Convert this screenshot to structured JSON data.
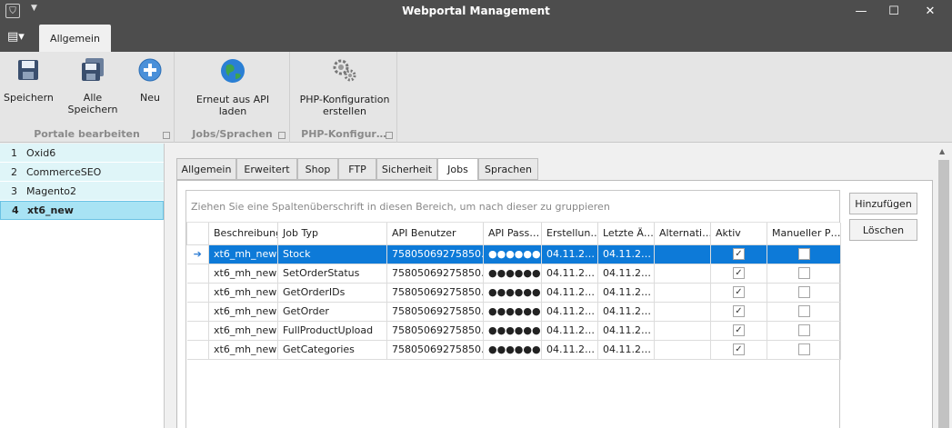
{
  "window": {
    "title": "Webportal Management",
    "minimize": "—",
    "maximize": "☐",
    "close": "✕"
  },
  "ribbon": {
    "tab": "Allgemein",
    "groups": [
      {
        "label": "Portale bearbeiten",
        "buttons": [
          "Speichern",
          "Alle Speichern",
          "Neu"
        ]
      },
      {
        "label": "Jobs/Sprachen",
        "buttons": [
          "Erneut aus API laden"
        ]
      },
      {
        "label": "PHP-Konfigur…",
        "buttons": [
          "PHP-Konfiguration erstellen"
        ]
      }
    ]
  },
  "portals": [
    {
      "num": "1",
      "name": "Oxid6"
    },
    {
      "num": "2",
      "name": "CommerceSEO"
    },
    {
      "num": "3",
      "name": "Magento2"
    },
    {
      "num": "4",
      "name": "xt6_new"
    }
  ],
  "tabs": [
    "Allgemein",
    "Erweitert",
    "Shop",
    "FTP",
    "Sicherheit",
    "Jobs",
    "Sprachen"
  ],
  "active_tab": "Jobs",
  "grid": {
    "group_hint": "Ziehen Sie eine Spaltenüberschrift in diesen Bereich, um nach dieser zu gruppieren",
    "columns": [
      "Beschreibung",
      "Job Typ",
      "API Benutzer",
      "API Pass…",
      "Erstellun…",
      "Letzte Ä…",
      "Alternati…",
      "Aktiv",
      "Manueller P…"
    ],
    "rows": [
      {
        "desc": "xt6_mh_new",
        "type": "Stock",
        "user": "75805069275850…",
        "pass": "●●●●●●…",
        "created": "04.11.2…",
        "changed": "04.11.2…",
        "alt": "",
        "active": "✓",
        "manual": ""
      },
      {
        "desc": "xt6_mh_new",
        "type": "SetOrderStatus",
        "user": "75805069275850…",
        "pass": "●●●●●●…",
        "created": "04.11.2…",
        "changed": "04.11.2…",
        "alt": "",
        "active": "✓",
        "manual": ""
      },
      {
        "desc": "xt6_mh_new",
        "type": "GetOrderIDs",
        "user": "75805069275850…",
        "pass": "●●●●●●…",
        "created": "04.11.2…",
        "changed": "04.11.2…",
        "alt": "",
        "active": "✓",
        "manual": ""
      },
      {
        "desc": "xt6_mh_new",
        "type": "GetOrder",
        "user": "75805069275850…",
        "pass": "●●●●●●…",
        "created": "04.11.2…",
        "changed": "04.11.2…",
        "alt": "",
        "active": "✓",
        "manual": ""
      },
      {
        "desc": "xt6_mh_new",
        "type": "FullProductUpload",
        "user": "75805069275850…",
        "pass": "●●●●●●…",
        "created": "04.11.2…",
        "changed": "04.11.2…",
        "alt": "",
        "active": "✓",
        "manual": ""
      },
      {
        "desc": "xt6_mh_new",
        "type": "GetCategories",
        "user": "75805069275850…",
        "pass": "●●●●●●…",
        "created": "04.11.2…",
        "changed": "04.11.2…",
        "alt": "",
        "active": "✓",
        "manual": ""
      }
    ],
    "row_indicator": "➔"
  },
  "actions": {
    "add": "Hinzufügen",
    "delete": "Löschen"
  },
  "colors": {
    "titlebar": "#4d4d4d",
    "selection": "#0d7ad8",
    "list_bg": "#dff5f8",
    "list_selected": "#a8e3f4"
  }
}
